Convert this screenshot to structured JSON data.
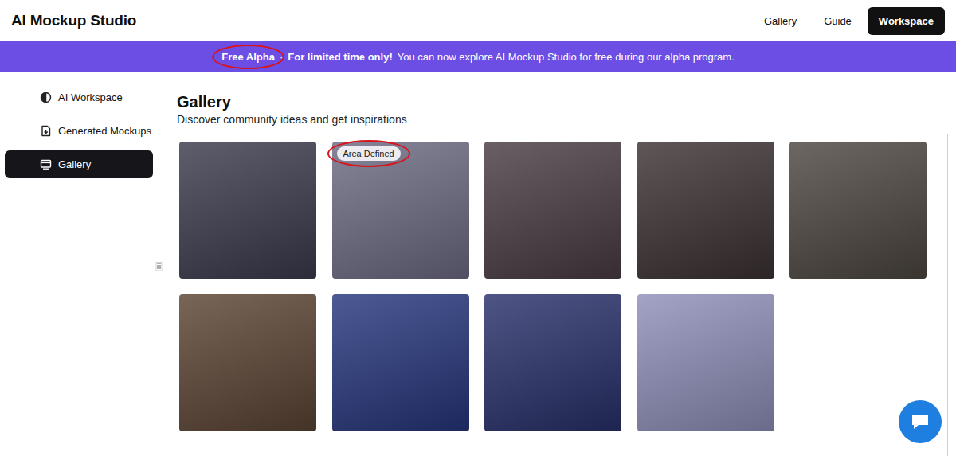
{
  "header": {
    "logo": "AI Mockup Studio",
    "nav": [
      {
        "label": "Gallery",
        "kind": "link"
      },
      {
        "label": "Guide",
        "kind": "link"
      },
      {
        "label": "Workspace",
        "kind": "button"
      }
    ]
  },
  "banner": {
    "badge": "Free Alpha",
    "separator": "·",
    "highlight": "For limited time only!",
    "text": "You can now explore AI Mockup Studio for free during our alpha program."
  },
  "sidebar": {
    "items": [
      {
        "label": "AI Workspace",
        "selected": false
      },
      {
        "label": "Generated Mockups",
        "selected": false
      },
      {
        "label": "Gallery",
        "selected": true
      }
    ]
  },
  "gallery": {
    "title": "Gallery",
    "subtitle": "Discover community ideas and get inspirations",
    "cards": [
      {
        "color": "#3b3a4c"
      },
      {
        "color": "#6c6a82",
        "badge": "Area Defined"
      },
      {
        "color": "#4a3b44"
      },
      {
        "color": "#3c3232"
      },
      {
        "color": "#4c4640"
      },
      {
        "color": "#5a4433"
      },
      {
        "color": "#26357c"
      },
      {
        "color": "#27306a"
      },
      {
        "color": "#8e8fb9"
      }
    ]
  }
}
